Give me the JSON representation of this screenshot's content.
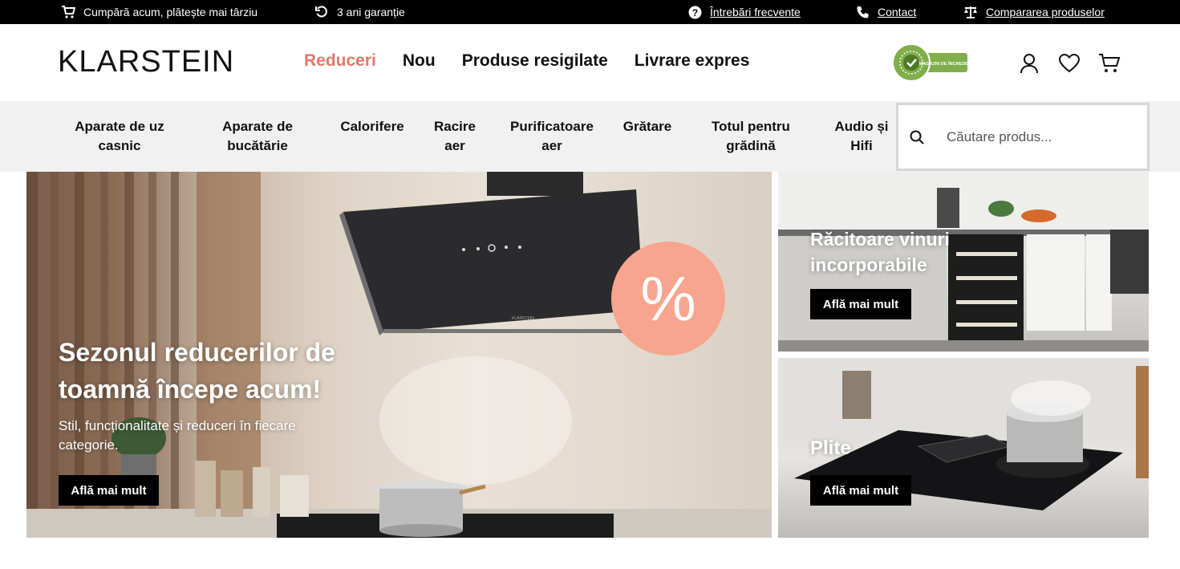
{
  "topbar": {
    "bnpl": "Cumpără acum, plătește mai târziu",
    "warranty": "3 ani garanție",
    "faq": "Întrebări frecvente",
    "contact": "Contact",
    "compare": "Compararea produselor"
  },
  "header": {
    "logo": "KLARSTEIN",
    "nav": [
      "Reduceri",
      "Nou",
      "Produse resigilate",
      "Livrare expres"
    ],
    "badge_text": "MAGAZIN DE ÎNCREDERE"
  },
  "categories": [
    "Aparate de uz casnic",
    "Aparate de bucătărie",
    "Calorifere",
    "Racire aer",
    "Purificatoare aer",
    "Grătare",
    "Totul pentru grădină",
    "Audio și Hifi"
  ],
  "search": {
    "placeholder": "Căutare produs..."
  },
  "hero": {
    "main": {
      "title_line1": "Sezonul reducerilor de",
      "title_line2": "toamnă începe acum!",
      "sub_line1": "Stil, funcționalitate și reduceri în fiecare",
      "sub_line2": "categorie.",
      "cta": "Află mai mult",
      "discount_symbol": "%",
      "product_label": "KLARSTEIN"
    },
    "wine": {
      "title_line1": "Răcitoare vinuri",
      "title_line2": "incorporabile",
      "cta": "Află mai mult"
    },
    "hob": {
      "title": "Plite",
      "cta": "Află mai mult"
    }
  },
  "colors": {
    "accent": "#e0786b",
    "discount_circle": "#f7a58e",
    "topbar": "#000000",
    "catbar": "#f1f1f1"
  }
}
